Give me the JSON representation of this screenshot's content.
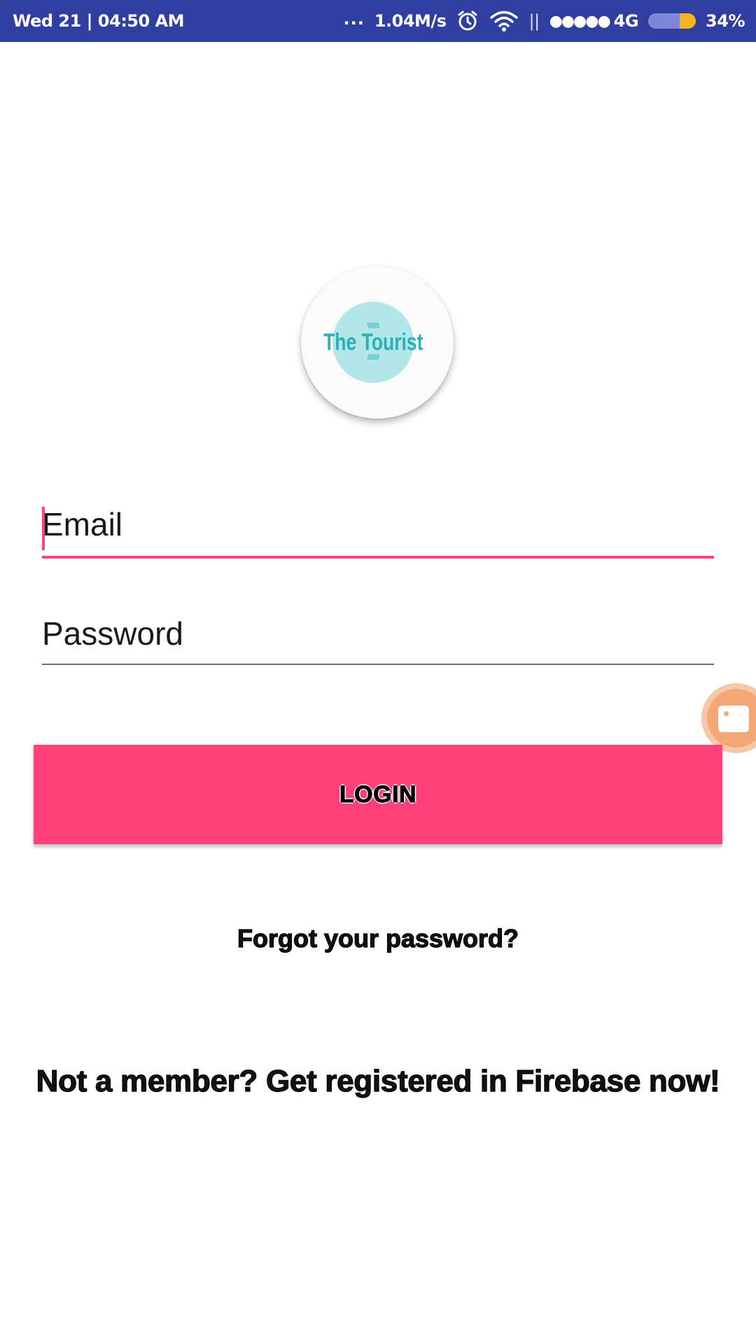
{
  "status_bar": {
    "datetime": "Wed 21 | 04:50 AM",
    "dots": "...",
    "net_speed": "1.04M/s",
    "separator": "||",
    "signal": "●●●●●",
    "network_type": "4G",
    "battery_percent": "34%",
    "battery_level": 0.34,
    "icons": [
      "alarm-icon",
      "wifi-icon",
      "signal-icon",
      "battery-icon"
    ]
  },
  "logo": {
    "text": "The Tourist",
    "laurel_top": "\\\\\\\\\\\\\\\\",
    "laurel_bottom": "////////"
  },
  "form": {
    "email": {
      "placeholder": "Email",
      "value": ""
    },
    "password": {
      "placeholder": "Password",
      "value": ""
    },
    "login_label": "LOGIN"
  },
  "links": {
    "forgot_password": "Forgot your password?",
    "register": "Not a member? Get registered in Firebase now!"
  },
  "colors": {
    "status_bar": "#303f9f",
    "accent": "#ff4081",
    "button": "#ff407b",
    "logo_bg": "#b2e6e8",
    "logo_text": "#2ab0b8"
  },
  "floating_bubble": {
    "icon": "video-camera-icon"
  }
}
